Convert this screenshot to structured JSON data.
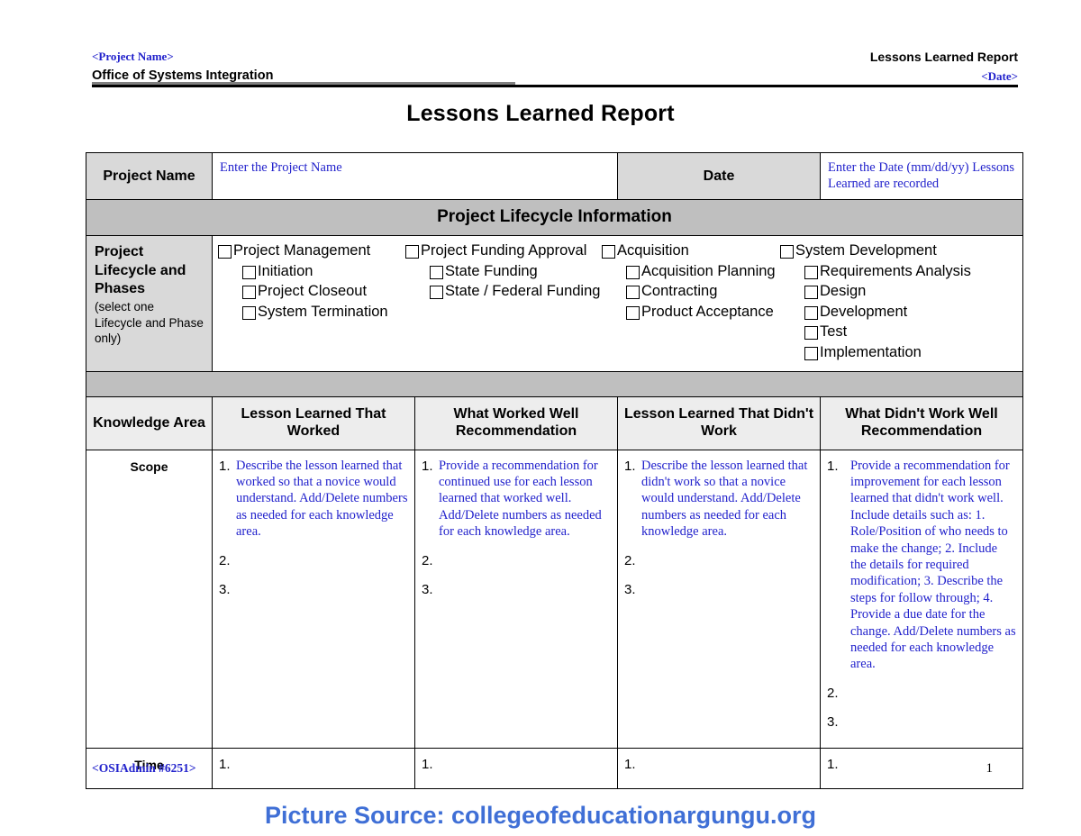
{
  "header": {
    "left_top": "<Project Name>",
    "left_bottom": "Office of Systems Integration",
    "right_top": "Lessons Learned Report",
    "right_bottom": "<Date>"
  },
  "title": "Lessons Learned Report",
  "info_table": {
    "project_name_label": "Project Name",
    "project_name_value": "Enter the Project Name",
    "date_label": "Date",
    "date_value": "Enter the Date (mm/dd/yy) Lessons Learned are recorded",
    "section_band": "Project Lifecycle Information"
  },
  "lifecycle": {
    "label_title": "Project Lifecycle and Phases",
    "label_note": "(select one Lifecycle and Phase only)",
    "columns": [
      {
        "parent": "Project Management",
        "children": [
          "Initiation",
          "Project Closeout",
          "System Termination"
        ]
      },
      {
        "parent": "Project Funding Approval",
        "children": [
          "State Funding",
          "State / Federal Funding"
        ]
      },
      {
        "parent": "Acquisition",
        "children": [
          "Acquisition Planning",
          "Contracting",
          "Product Acceptance"
        ]
      },
      {
        "parent": "System Development",
        "children": [
          "Requirements Analysis",
          "Design",
          "Development",
          "Test",
          "Implementation"
        ]
      }
    ]
  },
  "knowledge_table": {
    "headers": [
      "Knowledge Area",
      "Lesson Learned That Worked",
      "What Worked Well Recommendation",
      "Lesson Learned That Didn't Work",
      "What Didn't Work Well Recommendation"
    ],
    "rows": [
      {
        "area": "Scope",
        "cells": [
          {
            "items": [
              {
                "num": "1.",
                "text": "Describe the lesson learned that worked so that a novice would understand. Add/Delete numbers as needed for each knowledge area."
              },
              {
                "num": "2.",
                "text": ""
              },
              {
                "num": "3.",
                "text": ""
              }
            ]
          },
          {
            "items": [
              {
                "num": "1.",
                "text": "Provide a recommendation for continued use for each lesson learned that worked well. Add/Delete numbers as needed for each knowledge area."
              },
              {
                "num": "2.",
                "text": ""
              },
              {
                "num": "3.",
                "text": ""
              }
            ]
          },
          {
            "items": [
              {
                "num": "1.",
                "text": "Describe the lesson learned that didn't work so that a novice would understand. Add/Delete numbers as needed for each knowledge area."
              },
              {
                "num": "2.",
                "text": ""
              },
              {
                "num": "3.",
                "text": ""
              }
            ]
          },
          {
            "items": [
              {
                "num": "1.",
                "text": "Provide a recommendation for improvement for each lesson learned that didn't work well. Include details such as: 1. Role/Position of who needs to make the change; 2. Include the details for required modification; 3. Describe the steps for follow through; 4. Provide a due date for the change. Add/Delete numbers as needed for each knowledge area."
              },
              {
                "num": "2.",
                "text": ""
              },
              {
                "num": "3.",
                "text": ""
              }
            ]
          }
        ]
      },
      {
        "area": "Time",
        "cells": [
          {
            "items": [
              {
                "num": "1.",
                "text": ""
              }
            ]
          },
          {
            "items": [
              {
                "num": "1.",
                "text": ""
              }
            ]
          },
          {
            "items": [
              {
                "num": "1.",
                "text": ""
              }
            ]
          },
          {
            "items": [
              {
                "num": "1.",
                "text": ""
              }
            ]
          }
        ]
      }
    ]
  },
  "footer": {
    "left": "<OSIAdmin #6251>",
    "page_number": "1"
  },
  "source_caption": "Picture Source: collegeofeducationargungu.org",
  "colors": {
    "link_blue": "#2222cc",
    "band_gray": "#bfbfbf",
    "label_gray": "#d9d9d9",
    "header_gray": "#ededed",
    "caption_blue": "#3f6fd6"
  }
}
